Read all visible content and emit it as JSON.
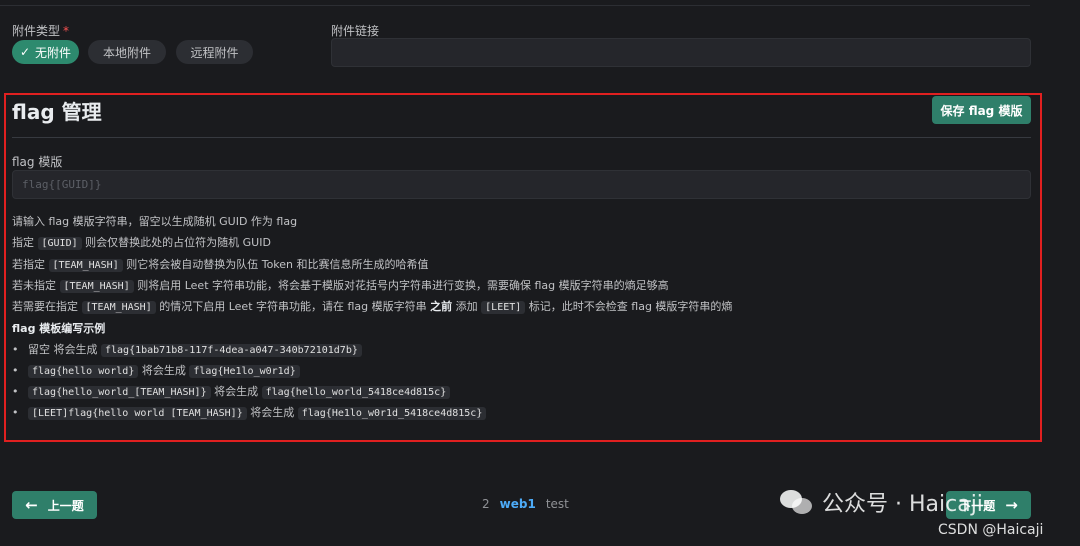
{
  "attachment": {
    "type_label": "附件类型",
    "required_mark": "*",
    "options": [
      "无附件",
      "本地附件",
      "远程附件"
    ],
    "selected": "无附件",
    "link_label": "附件链接",
    "link_value": ""
  },
  "flag_section": {
    "title": "flag 管理",
    "save_label": "保存 flag 模版",
    "template_label": "flag 模版",
    "template_placeholder": "flag{[GUID]}",
    "help": {
      "l1": "请输入 flag 模版字符串，留空以生成随机 GUID 作为 flag",
      "l2a": "指定",
      "l2code": "[GUID]",
      "l2b": "则会仅替换此处的占位符为随机 GUID",
      "l3a": "若指定",
      "l3code": "[TEAM_HASH]",
      "l3b": "则它将会被自动替换为队伍 Token 和比赛信息所生成的哈希值",
      "l4a": "若未指定",
      "l4code": "[TEAM_HASH]",
      "l4b": "则将启用 Leet 字符串功能，将会基于模版对花括号内字符串进行变换，需要确保 flag 模版字符串的熵足够高",
      "l5a": "若需要在指定",
      "l5code": "[TEAM_HASH]",
      "l5b": "的情况下启用 Leet 字符串功能，请在 flag 模版字符串",
      "l5bold": "之前",
      "l5c": "添加",
      "l5code2": "[LEET]",
      "l5d": "标记，此时不会检查 flag 模版字符串的熵"
    },
    "examples_title": "flag 模板编写示例",
    "examples": [
      {
        "input": "留空",
        "input_is_code": false,
        "sep": "将会生成",
        "output": "flag{1bab71b8-117f-4dea-a047-340b72101d7b}"
      },
      {
        "input": "flag{hello world}",
        "input_is_code": true,
        "sep": "将会生成",
        "output": "flag{He1lo_w0r1d}"
      },
      {
        "input": "flag{hello_world_[TEAM_HASH]}",
        "input_is_code": true,
        "sep": "将会生成",
        "output": "flag{hello_world_5418ce4d815c}"
      },
      {
        "input": "[LEET]flag{hello world [TEAM_HASH]}",
        "input_is_code": true,
        "sep": "将会生成",
        "output": "flag{He1lo_w0r1d_5418ce4d815c}"
      }
    ]
  },
  "footer": {
    "prev_label": "上一题",
    "next_label": "下一题",
    "step_number": "2",
    "current_name": "web1",
    "next_name": "test"
  },
  "watermark": {
    "wechat": "公众号 · Haicaji",
    "csdn": "CSDN @Haicaji"
  },
  "colors": {
    "background": "#1a1b1e",
    "accent": "#2f7f6a",
    "highlight_frame": "#e02020",
    "link": "#4dabf7"
  }
}
